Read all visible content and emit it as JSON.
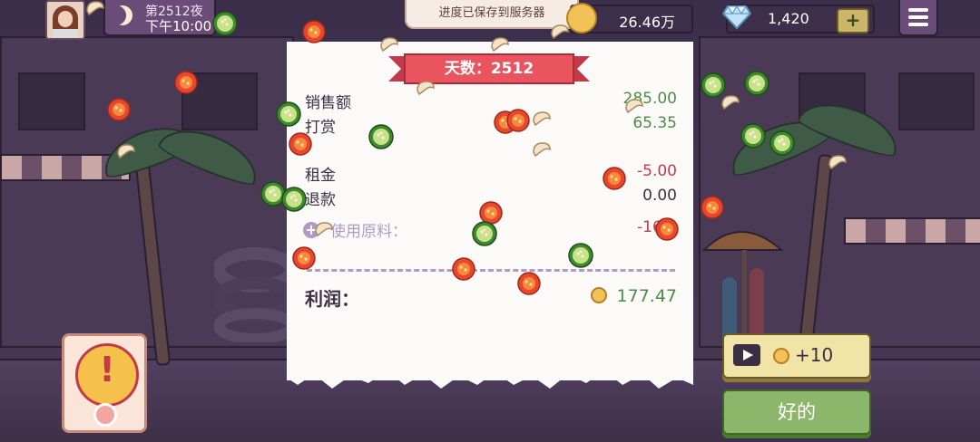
{
  "top_bar": {
    "day_label": "第2512夜",
    "time_label": "下午10:00",
    "toast": "进度已保存到服务器",
    "coins": "26.46万",
    "gems": "1,420",
    "gem_plus": "+"
  },
  "receipt": {
    "ribbon_title": "天数：2512",
    "rows": [
      {
        "label": "销售额",
        "value": "285.00"
      },
      {
        "label": "打赏",
        "value": "65.35"
      },
      {
        "label": "租金",
        "value": "-5.00"
      },
      {
        "label": "退款",
        "value": "0.00"
      }
    ],
    "material_label": "使用原料：",
    "material_value": "-167.",
    "profit_label": "利润：",
    "profit_value": "177.47"
  },
  "buttons": {
    "ad_reward": "+10",
    "ok": "好的"
  },
  "colors": {
    "positive": "#4f8a4a",
    "negative": "#c23a49",
    "ribbon": "#e9545e",
    "ok_button": "#8cb76b"
  }
}
